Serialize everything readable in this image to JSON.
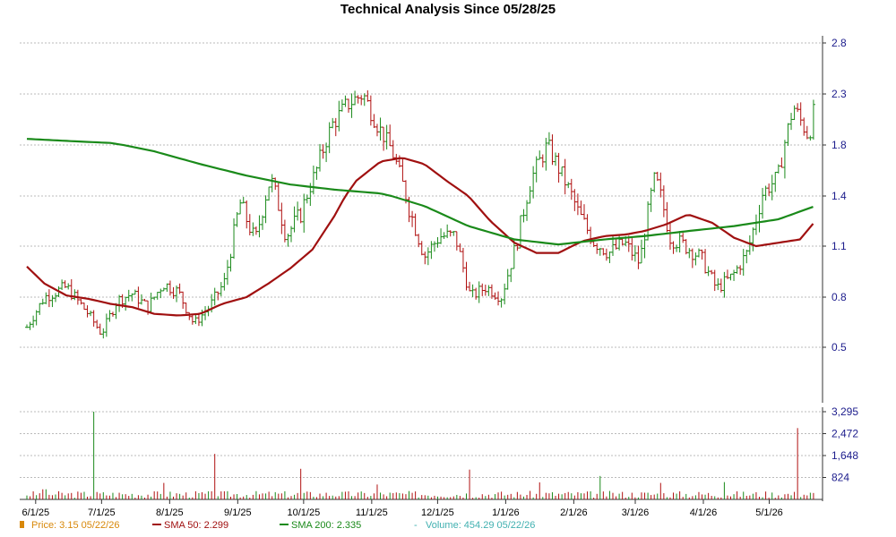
{
  "chart_data": {
    "type": "line",
    "title": "Technical Analysis Since 05/28/25",
    "price_axis": {
      "ticks": [
        0.5,
        0.8,
        1.1,
        1.4,
        1.8,
        2.3,
        2.8
      ],
      "tick_labels": [
        "0.5",
        "0.8",
        "1.1",
        "1.4",
        "1.8",
        "2.3",
        "2.8"
      ]
    },
    "volume_axis": {
      "ticks": [
        824,
        1648,
        2472,
        3295
      ],
      "tick_labels": [
        "824",
        "1,648",
        "2,472",
        "3,295"
      ]
    },
    "x_tick_labels": [
      "6/1/25",
      "7/1/25",
      "8/1/25",
      "9/1/25",
      "10/1/25",
      "11/1/25",
      "12/1/25",
      "1/1/26",
      "2/1/26",
      "3/1/26",
      "4/1/26",
      "5/1/26"
    ],
    "series": [
      {
        "name": "SMA 50",
        "color": "#a01010",
        "x": [
          "2025-05-28",
          "2025-06-05",
          "2025-06-15",
          "2025-06-25",
          "2025-07-05",
          "2025-07-15",
          "2025-07-25",
          "2025-08-05",
          "2025-08-15",
          "2025-08-25",
          "2025-09-05",
          "2025-09-15",
          "2025-09-25",
          "2025-10-05",
          "2025-10-15",
          "2025-10-25",
          "2025-11-05",
          "2025-11-15",
          "2025-11-25",
          "2025-12-05",
          "2025-12-15",
          "2025-12-25",
          "2026-01-05",
          "2026-01-15",
          "2026-01-25",
          "2026-02-05",
          "2026-02-15",
          "2026-02-25",
          "2026-03-05",
          "2026-03-15",
          "2026-03-25",
          "2026-04-05",
          "2026-04-15",
          "2026-04-25",
          "2026-05-05",
          "2026-05-15",
          "2026-05-22"
        ],
        "values": [
          0.98,
          0.88,
          0.81,
          0.79,
          0.76,
          0.74,
          0.7,
          0.69,
          0.7,
          0.76,
          0.8,
          0.88,
          0.97,
          1.08,
          1.28,
          1.52,
          1.67,
          1.7,
          1.65,
          1.52,
          1.4,
          1.25,
          1.12,
          1.06,
          1.06,
          1.13,
          1.16,
          1.17,
          1.19,
          1.23,
          1.29,
          1.24,
          1.15,
          1.1,
          1.12,
          1.14,
          1.25
        ]
      },
      {
        "name": "SMA 200",
        "color": "#1a8a1a",
        "x": [
          "2025-05-28",
          "2025-06-15",
          "2025-07-05",
          "2025-07-25",
          "2025-08-15",
          "2025-09-05",
          "2025-09-25",
          "2025-10-15",
          "2025-11-05",
          "2025-11-25",
          "2025-12-15",
          "2026-01-05",
          "2026-01-25",
          "2026-02-15",
          "2026-03-05",
          "2026-03-25",
          "2026-04-15",
          "2026-05-05",
          "2026-05-22"
        ],
        "values": [
          1.86,
          1.84,
          1.82,
          1.75,
          1.65,
          1.56,
          1.49,
          1.45,
          1.42,
          1.34,
          1.22,
          1.14,
          1.11,
          1.14,
          1.16,
          1.19,
          1.22,
          1.26,
          1.34
        ]
      },
      {
        "name": "Price",
        "color": "#d8880a",
        "x": [
          "2025-05-28",
          "2025-06-05",
          "2025-06-15",
          "2025-06-25",
          "2025-07-01",
          "2025-07-08",
          "2025-07-15",
          "2025-07-22",
          "2025-07-29",
          "2025-08-05",
          "2025-08-12",
          "2025-08-19",
          "2025-08-26",
          "2025-09-02",
          "2025-09-09",
          "2025-09-16",
          "2025-09-23",
          "2025-09-30",
          "2025-10-07",
          "2025-10-14",
          "2025-10-21",
          "2025-10-28",
          "2025-11-04",
          "2025-11-11",
          "2025-11-18",
          "2025-11-25",
          "2025-12-02",
          "2025-12-09",
          "2025-12-16",
          "2025-12-23",
          "2025-12-30",
          "2026-01-06",
          "2026-01-13",
          "2026-01-20",
          "2026-01-27",
          "2026-02-03",
          "2026-02-10",
          "2026-02-17",
          "2026-02-24",
          "2026-03-03",
          "2026-03-10",
          "2026-03-17",
          "2026-03-24",
          "2026-03-31",
          "2026-04-07",
          "2026-04-14",
          "2026-04-21",
          "2026-04-28",
          "2026-05-05",
          "2026-05-12",
          "2026-05-19",
          "2026-05-22"
        ],
        "values": [
          0.62,
          0.8,
          0.86,
          0.7,
          0.58,
          0.78,
          0.82,
          0.74,
          0.88,
          0.83,
          0.64,
          0.74,
          0.89,
          1.36,
          1.13,
          1.54,
          1.16,
          1.3,
          1.61,
          2.0,
          2.2,
          2.3,
          1.98,
          1.72,
          1.33,
          1.04,
          1.16,
          1.16,
          0.8,
          0.86,
          0.8,
          1.12,
          1.55,
          1.8,
          1.55,
          1.3,
          1.13,
          1.06,
          1.12,
          1.0,
          1.55,
          1.15,
          1.1,
          1.03,
          0.85,
          0.92,
          1.06,
          1.42,
          1.55,
          2.18,
          1.88,
          2.2
        ]
      }
    ],
    "volume": {
      "name": "Volume",
      "x": [
        "2025-06-05",
        "2025-06-28",
        "2025-07-29",
        "2025-08-22",
        "2025-09-30",
        "2025-11-03",
        "2025-12-16",
        "2026-01-16",
        "2026-02-13",
        "2026-03-13",
        "2026-04-10",
        "2026-05-14"
      ],
      "values": [
        380,
        3295,
        620,
        1710,
        1150,
        560,
        1120,
        640,
        880,
        620,
        650,
        2680
      ]
    },
    "legend": [
      {
        "key": "price",
        "label": "Price: 3.15  05/22/26",
        "color": "#d8880a"
      },
      {
        "key": "sma50",
        "label": "SMA 50: 2.299",
        "color": "#a01010"
      },
      {
        "key": "sma200",
        "label": "SMA 200: 2.335",
        "color": "#1a8a1a"
      },
      {
        "key": "volume",
        "label": "Volume: 454.29  05/22/26",
        "color": "#40b0b0"
      }
    ],
    "grid": true,
    "legend_position": "bottom-left"
  }
}
